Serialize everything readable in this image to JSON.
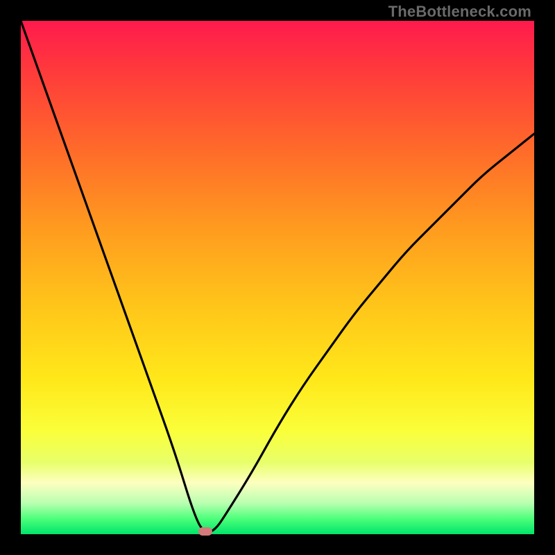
{
  "watermark": "TheBottleneck.com",
  "colors": {
    "frame": "#000000",
    "curve": "#000000",
    "marker": "#d47a7a",
    "gradient_top": "#ff1a4d",
    "gradient_bottom": "#00e46a"
  },
  "chart_data": {
    "type": "line",
    "title": "",
    "xlabel": "",
    "ylabel": "",
    "xlim": [
      0,
      100
    ],
    "ylim": [
      0,
      100
    ],
    "grid": false,
    "legend": false,
    "series": [
      {
        "name": "bottleneck-curve",
        "x": [
          0,
          5,
          10,
          15,
          20,
          25,
          30,
          34,
          36,
          38,
          40,
          45,
          50,
          55,
          60,
          65,
          70,
          75,
          80,
          85,
          90,
          95,
          100
        ],
        "y": [
          100,
          86,
          72,
          58,
          44,
          30,
          16,
          3,
          0,
          1,
          4,
          12,
          21,
          29,
          36,
          43,
          49,
          55,
          60,
          65,
          70,
          74,
          78
        ]
      }
    ],
    "annotations": [
      {
        "name": "optimum-marker",
        "x": 36,
        "y": 0
      }
    ]
  }
}
